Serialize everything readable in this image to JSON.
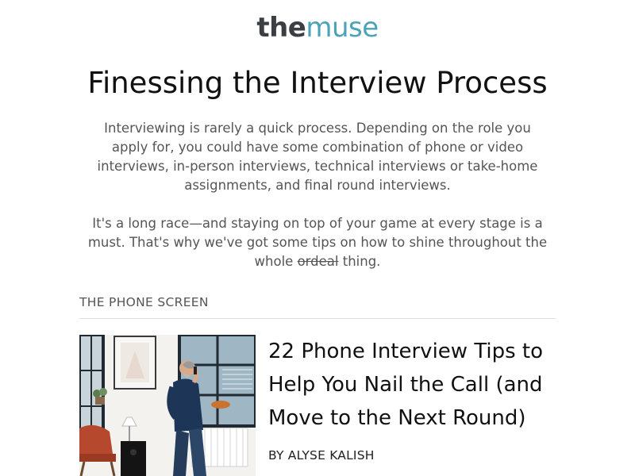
{
  "brand": {
    "logo_the": "the",
    "logo_muse": "muse",
    "accent_color": "#4aa3b7",
    "dark_color": "#3b3f44"
  },
  "headline": "Finessing the Interview Process",
  "intro": {
    "p1": "Interviewing is rarely a quick process. Depending on the role you apply for, you could have some combination of phone or video interviews, in-person interviews, technical interviews or take-home assignments, and final round interviews.",
    "p2_start": "It's a long race—and staying on top of your game at every stage is a must. That's why we've got some tips on how to shine throughout the whole ",
    "p2_struck": "ordeal",
    "p2_end": " thing."
  },
  "section": {
    "label": "THE PHONE SCREEN"
  },
  "article": {
    "title": "22 Phone Interview Tips to Help You Nail the Call (and Move to the Next Round)",
    "byline": "BY ALYSE KALISH",
    "image_icon": "man-on-phone-photo"
  }
}
